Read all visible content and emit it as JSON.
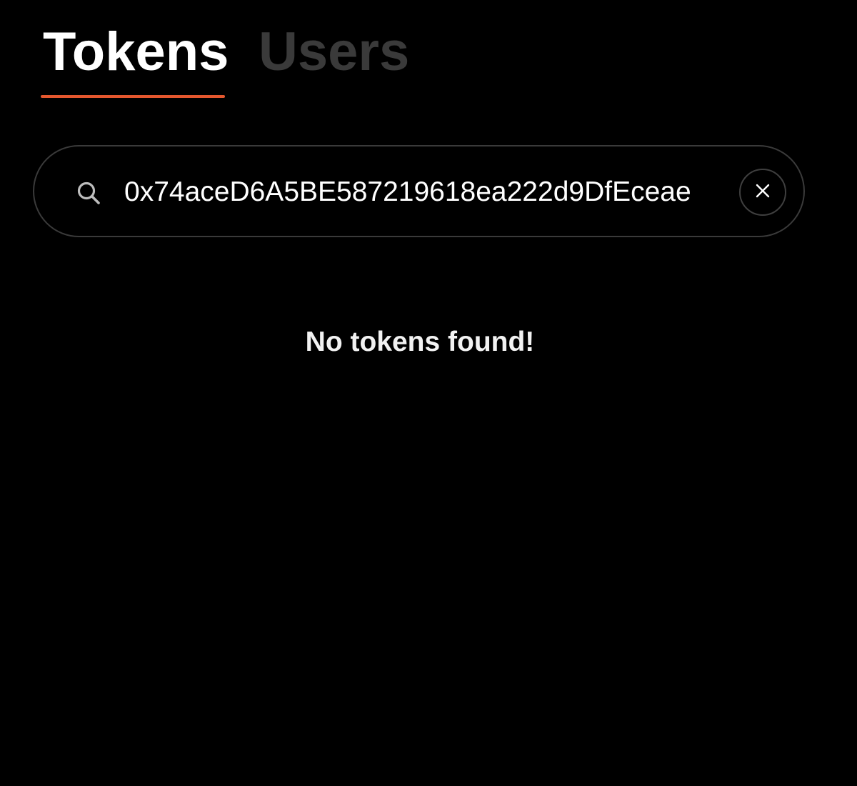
{
  "tabs": {
    "tokens_label": "Tokens",
    "users_label": "Users",
    "active": "Tokens",
    "inactive_color": "#3a3a3a",
    "accent_color": "#e4572e"
  },
  "search": {
    "value": "0x74aceD6A5BE587219618ea222d9DfEceae",
    "placeholder": "",
    "icon": "search-icon",
    "clear_icon": "close-icon"
  },
  "results": {
    "empty_message": "No tokens found!"
  }
}
